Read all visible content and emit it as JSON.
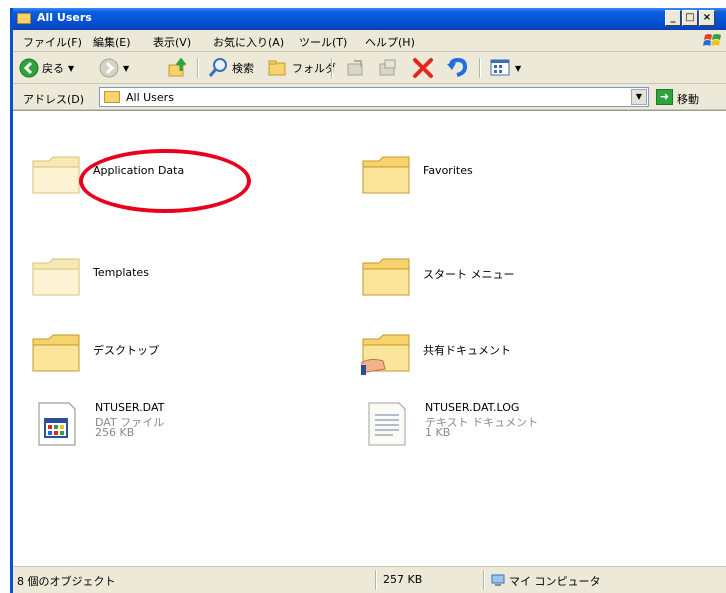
{
  "window": {
    "title": "All Users"
  },
  "titlebar_buttons": [
    "_",
    "□",
    "×"
  ],
  "menu": [
    {
      "label": "ファイル(F)"
    },
    {
      "label": "編集(E)"
    },
    {
      "label": "表示(V)"
    },
    {
      "label": "お気に入り(A)"
    },
    {
      "label": "ツール(T)"
    },
    {
      "label": "ヘルプ(H)"
    }
  ],
  "toolbar": {
    "back_label": "戻る",
    "search_label": "検索",
    "folders_label": "フォルダ"
  },
  "address": {
    "label": "アドレス(D)",
    "value": "All Users",
    "go_label": "移動"
  },
  "items": [
    {
      "name": "Application Data",
      "icon": "folder-icon"
    },
    {
      "name": "Favorites",
      "icon": "folder-icon"
    },
    {
      "name": "Templates",
      "icon": "folder-icon"
    },
    {
      "name": "スタート メニュー",
      "icon": "folder-icon"
    },
    {
      "name": "デスクトップ",
      "icon": "folder-icon"
    },
    {
      "name": "共有ドキュメント",
      "icon": "shared-folder-icon"
    },
    {
      "name": "NTUSER.DAT",
      "type": "DAT ファイル",
      "size": "256 KB",
      "icon": "dat-file-icon"
    },
    {
      "name": "NTUSER.DAT.LOG",
      "type": "テキスト ドキュメント",
      "size": "1 KB",
      "icon": "text-document-icon"
    }
  ],
  "status": {
    "objects": "8 個のオブジェクト",
    "size": "257 KB",
    "location": "マイ コンピュータ"
  },
  "colors": {
    "titlebar": "#0553d6",
    "highlight": "#e8001c",
    "folder": "#f6d36c"
  }
}
